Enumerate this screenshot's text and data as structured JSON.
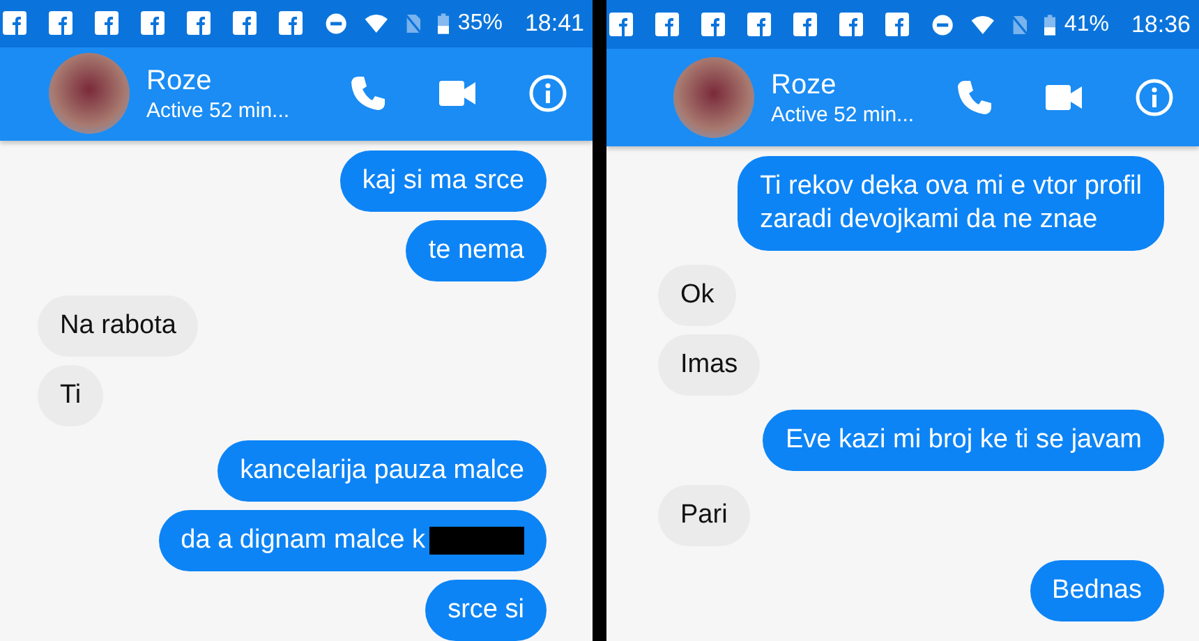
{
  "screens": [
    {
      "status_bar": {
        "battery": "35%",
        "time": "18:41"
      },
      "header": {
        "name": "Roze",
        "status": "Active 52 min..."
      },
      "messages": [
        {
          "kind": "sent",
          "text": "kaj si ma srce"
        },
        {
          "kind": "sent",
          "text": "te nema"
        },
        {
          "kind": "received",
          "text": "Na rabota"
        },
        {
          "kind": "received",
          "text": "Ti"
        },
        {
          "kind": "sent",
          "text": "kancelarija pauza malce"
        },
        {
          "kind": "sent",
          "text": "da a dignam malce k",
          "redacted": true
        },
        {
          "kind": "sent",
          "text": "srce si"
        }
      ]
    },
    {
      "status_bar": {
        "battery": "41%",
        "time": "18:36"
      },
      "header": {
        "name": "Roze",
        "status": "Active 52 min..."
      },
      "messages": [
        {
          "kind": "sent",
          "text": "Ti rekov deka ova mi e vtor  profil\nzaradi devojkami da ne znae"
        },
        {
          "kind": "received",
          "text": "Ok"
        },
        {
          "kind": "received",
          "text": "Imas"
        },
        {
          "kind": "sent",
          "text": "Eve kazi mi broj ke ti se javam"
        },
        {
          "kind": "received",
          "text": "Pari"
        },
        {
          "kind": "sent",
          "text": "Bednas"
        }
      ]
    }
  ]
}
